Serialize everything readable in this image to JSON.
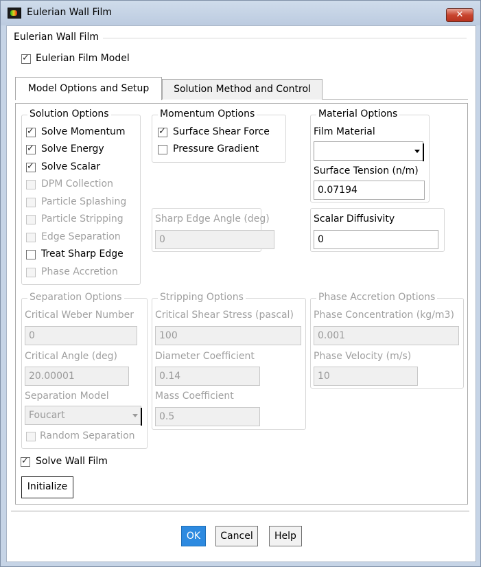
{
  "window": {
    "title": "Eulerian Wall Film",
    "close_glyph": "✕"
  },
  "outer_group": {
    "legend": "Eulerian Wall Film"
  },
  "film_model": {
    "label": "Eulerian Film Model",
    "checked": true
  },
  "tabs": [
    {
      "label": "Model Options and Setup",
      "active": true
    },
    {
      "label": "Solution Method and Control",
      "active": false
    }
  ],
  "solution_options": {
    "legend": "Solution Options",
    "items": [
      {
        "label": "Solve Momentum",
        "checked": true,
        "enabled": true
      },
      {
        "label": "Solve Energy",
        "checked": true,
        "enabled": true
      },
      {
        "label": "Solve Scalar",
        "checked": true,
        "enabled": true
      },
      {
        "label": "DPM Collection",
        "checked": false,
        "enabled": false
      },
      {
        "label": "Particle Splashing",
        "checked": false,
        "enabled": false
      },
      {
        "label": "Particle Stripping",
        "checked": false,
        "enabled": false
      },
      {
        "label": "Edge Separation",
        "checked": false,
        "enabled": false
      },
      {
        "label": "Treat Sharp Edge",
        "checked": false,
        "enabled": true
      },
      {
        "label": "Phase Accretion",
        "checked": false,
        "enabled": false
      }
    ]
  },
  "momentum_options": {
    "legend": "Momentum Options",
    "items": [
      {
        "label": "Surface Shear Force",
        "checked": true,
        "enabled": true
      },
      {
        "label": "Pressure Gradient",
        "checked": false,
        "enabled": true
      }
    ]
  },
  "material_options": {
    "legend": "Material Options",
    "film_material_label": "Film Material",
    "film_material_value": "",
    "surface_tension_label": "Surface Tension (n/m)",
    "surface_tension_value": "0.07194"
  },
  "sharp_edge": {
    "label": "Sharp Edge Angle (deg)",
    "value": "0"
  },
  "scalar_diffusivity": {
    "label": "Scalar Diffusivity",
    "value": "0"
  },
  "separation_options": {
    "legend": "Separation Options",
    "weber_label": "Critical Weber Number",
    "weber_value": "0",
    "angle_label": "Critical Angle (deg)",
    "angle_value": "20.00001",
    "model_label": "Separation Model",
    "model_value": "Foucart",
    "random_label": "Random Separation"
  },
  "stripping_options": {
    "legend": "Stripping Options",
    "shear_label": "Critical Shear Stress (pascal)",
    "shear_value": "100",
    "diameter_label": "Diameter Coefficient",
    "diameter_value": "0.14",
    "mass_label": "Mass Coefficient",
    "mass_value": "0.5"
  },
  "phase_accretion_options": {
    "legend": "Phase Accretion Options",
    "concentration_label": "Phase Concentration (kg/m3)",
    "concentration_value": "0.001",
    "velocity_label": "Phase Velocity (m/s)",
    "velocity_value": "10"
  },
  "solve_wall_film": {
    "label": "Solve Wall Film",
    "checked": true
  },
  "initialize_button": "Initialize",
  "buttons": {
    "ok": "OK",
    "cancel": "Cancel",
    "help": "Help"
  }
}
